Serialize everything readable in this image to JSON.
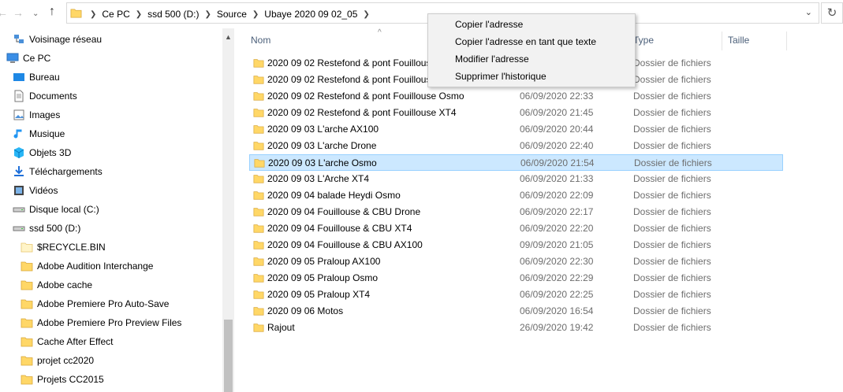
{
  "breadcrumb": [
    "Ce PC",
    "ssd 500 (D:)",
    "Source",
    "Ubaye 2020 09 02_05"
  ],
  "columns": {
    "name": "Nom",
    "type": "Type",
    "size": "Taille"
  },
  "sidebar": [
    {
      "label": "Voisinage réseau",
      "icon": "network-icon"
    },
    {
      "label": "Ce PC",
      "icon": "computer-icon"
    },
    {
      "label": "Bureau",
      "icon": "desktop-icon"
    },
    {
      "label": "Documents",
      "icon": "documents-icon"
    },
    {
      "label": "Images",
      "icon": "images-icon"
    },
    {
      "label": "Musique",
      "icon": "music-icon"
    },
    {
      "label": "Objets 3D",
      "icon": "objects-3d-icon"
    },
    {
      "label": "Téléchargements",
      "icon": "downloads-icon"
    },
    {
      "label": "Vidéos",
      "icon": "videos-icon"
    },
    {
      "label": "Disque local (C:)",
      "icon": "drive-icon"
    },
    {
      "label": "ssd 500 (D:)",
      "icon": "drive-icon"
    },
    {
      "label": "$RECYCLE.BIN",
      "icon": "recycle-folder-icon"
    },
    {
      "label": "Adobe Audition Interchange",
      "icon": "folder-icon"
    },
    {
      "label": "Adobe cache",
      "icon": "folder-icon"
    },
    {
      "label": "Adobe Premiere Pro Auto-Save",
      "icon": "folder-icon"
    },
    {
      "label": "Adobe Premiere Pro Preview Files",
      "icon": "folder-icon"
    },
    {
      "label": "Cache After Effect",
      "icon": "folder-icon"
    },
    {
      "label": "projet cc2020",
      "icon": "folder-icon"
    },
    {
      "label": "Projets CC2015",
      "icon": "folder-icon"
    }
  ],
  "files": [
    {
      "name": "2020 09 02 Restefond & pont Fouillous",
      "date": "",
      "type": "Dossier de fichiers"
    },
    {
      "name": "2020 09 02 Restefond & pont Fouillous",
      "date": "",
      "type": "Dossier de fichiers"
    },
    {
      "name": "2020 09 02 Restefond & pont Fouillouse Osmo",
      "date": "06/09/2020 22:33",
      "type": "Dossier de fichiers"
    },
    {
      "name": "2020 09 02 Restefond & pont Fouillouse XT4",
      "date": "06/09/2020 21:45",
      "type": "Dossier de fichiers"
    },
    {
      "name": "2020 09 03 L'arche  AX100",
      "date": "06/09/2020 20:44",
      "type": "Dossier de fichiers"
    },
    {
      "name": "2020 09 03 L'arche Drone",
      "date": "06/09/2020 22:40",
      "type": "Dossier de fichiers"
    },
    {
      "name": "2020 09 03 L'arche Osmo",
      "date": "06/09/2020 21:54",
      "type": "Dossier de fichiers",
      "selected": true
    },
    {
      "name": "2020 09 03 L'Arche XT4",
      "date": "06/09/2020 21:33",
      "type": "Dossier de fichiers"
    },
    {
      "name": "2020 09 04 balade Heydi Osmo",
      "date": "06/09/2020 22:09",
      "type": "Dossier de fichiers"
    },
    {
      "name": "2020 09 04 Fouillouse  & CBU Drone",
      "date": "06/09/2020 22:17",
      "type": "Dossier de fichiers"
    },
    {
      "name": "2020 09 04 Fouillouse  & CBU XT4",
      "date": "06/09/2020 22:20",
      "type": "Dossier de fichiers"
    },
    {
      "name": "2020 09 04 Fouillouse & CBU AX100",
      "date": "09/09/2020 21:05",
      "type": "Dossier de fichiers"
    },
    {
      "name": "2020 09 05 Praloup AX100",
      "date": "06/09/2020 22:30",
      "type": "Dossier de fichiers"
    },
    {
      "name": "2020 09 05 Praloup Osmo",
      "date": "06/09/2020 22:29",
      "type": "Dossier de fichiers"
    },
    {
      "name": "2020 09 05 Praloup XT4",
      "date": "06/09/2020 22:25",
      "type": "Dossier de fichiers"
    },
    {
      "name": "2020 09 06 Motos",
      "date": "06/09/2020 16:54",
      "type": "Dossier de fichiers"
    },
    {
      "name": "Rajout",
      "date": "26/09/2020 19:42",
      "type": "Dossier de fichiers"
    }
  ],
  "context_menu": [
    "Copier l'adresse",
    "Copier l'adresse en tant que texte",
    "Modifier l'adresse",
    "Supprimer l'historique"
  ],
  "colors": {
    "selection": "#cce8ff",
    "folder": "#ffd767",
    "header_text": "#4c607a"
  }
}
